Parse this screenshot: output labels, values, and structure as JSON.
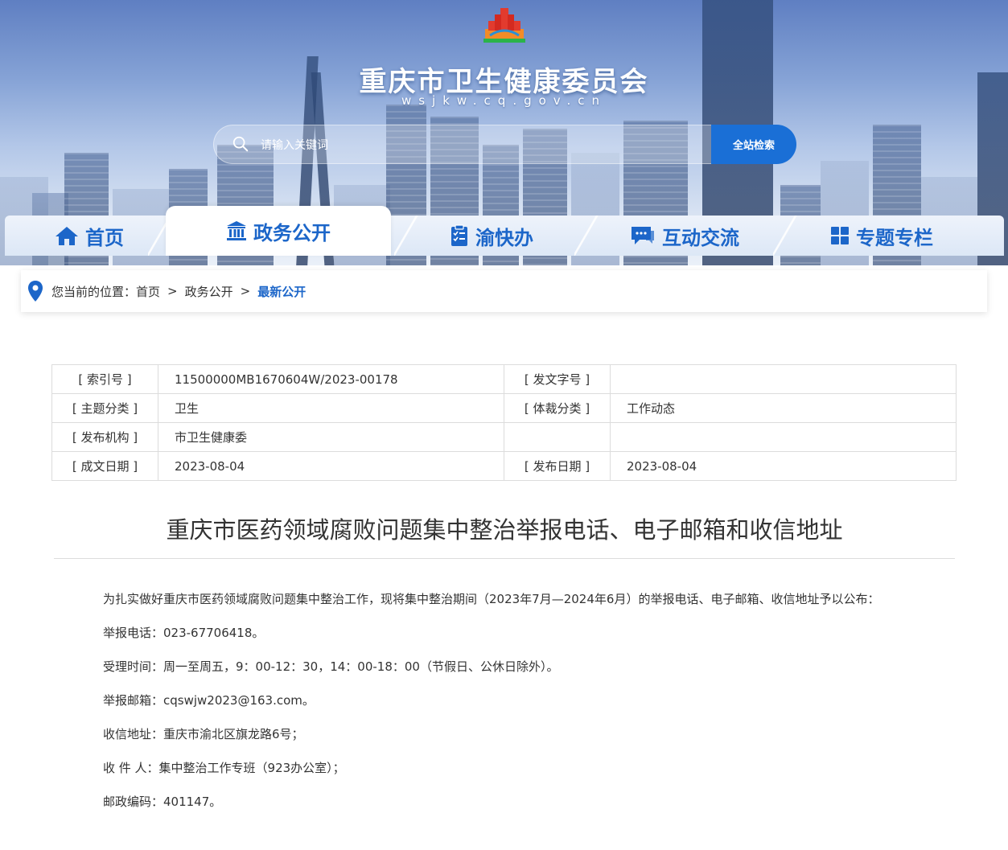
{
  "header": {
    "site_title": "重庆市卫生健康委员会",
    "site_domain": "wsjkw.cq.gov.cn",
    "search_placeholder": "请输入关键词",
    "search_button": "全站检索"
  },
  "nav": {
    "items": [
      {
        "label": "首页",
        "icon": "home-icon"
      },
      {
        "label": "政务公开",
        "icon": "government-building-icon"
      },
      {
        "label": "渝快办",
        "icon": "clipboard-check-icon"
      },
      {
        "label": "互动交流",
        "icon": "chat-bubbles-icon"
      },
      {
        "label": "专题专栏",
        "icon": "grid-tiles-icon"
      }
    ],
    "active": "政务公开"
  },
  "breadcrumb": {
    "prefix": "您当前的位置：",
    "items": [
      "首页",
      "政务公开",
      "最新公开"
    ],
    "separator": ">"
  },
  "meta": {
    "rows": [
      {
        "k1": "[ 索引号 ]",
        "v1": "11500000MB1670604W/2023-00178",
        "k2": "[ 发文字号 ]",
        "v2": ""
      },
      {
        "k1": "[ 主题分类 ]",
        "v1": "卫生",
        "k2": "[ 体裁分类 ]",
        "v2": "工作动态"
      },
      {
        "k1": "[ 发布机构 ]",
        "v1": "市卫生健康委",
        "k2": "",
        "v2": ""
      },
      {
        "k1": "[ 成文日期 ]",
        "v1": "2023-08-04",
        "k2": "[ 发布日期 ]",
        "v2": "2023-08-04"
      }
    ]
  },
  "article": {
    "title": "重庆市医药领域腐败问题集中整治举报电话、电子邮箱和收信地址",
    "paragraphs": [
      "为扎实做好重庆市医药领域腐败问题集中整治工作，现将集中整治期间（2023年7月—2024年6月）的举报电话、电子邮箱、收信地址予以公布：",
      "举报电话：023-67706418。",
      "受理时间：周一至周五，9：00-12：30，14：00-18：00（节假日、公休日除外）。",
      "举报邮箱：cqswjw2023@163.com。",
      "收信地址：重庆市渝北区旗龙路6号；",
      "收 件 人：集中整治工作专班（923办公室）；",
      "邮政编码：401147。"
    ]
  },
  "colors": {
    "accent": "#1c66c9",
    "search_button": "#1a6fd6",
    "border": "#dcdcdc"
  }
}
